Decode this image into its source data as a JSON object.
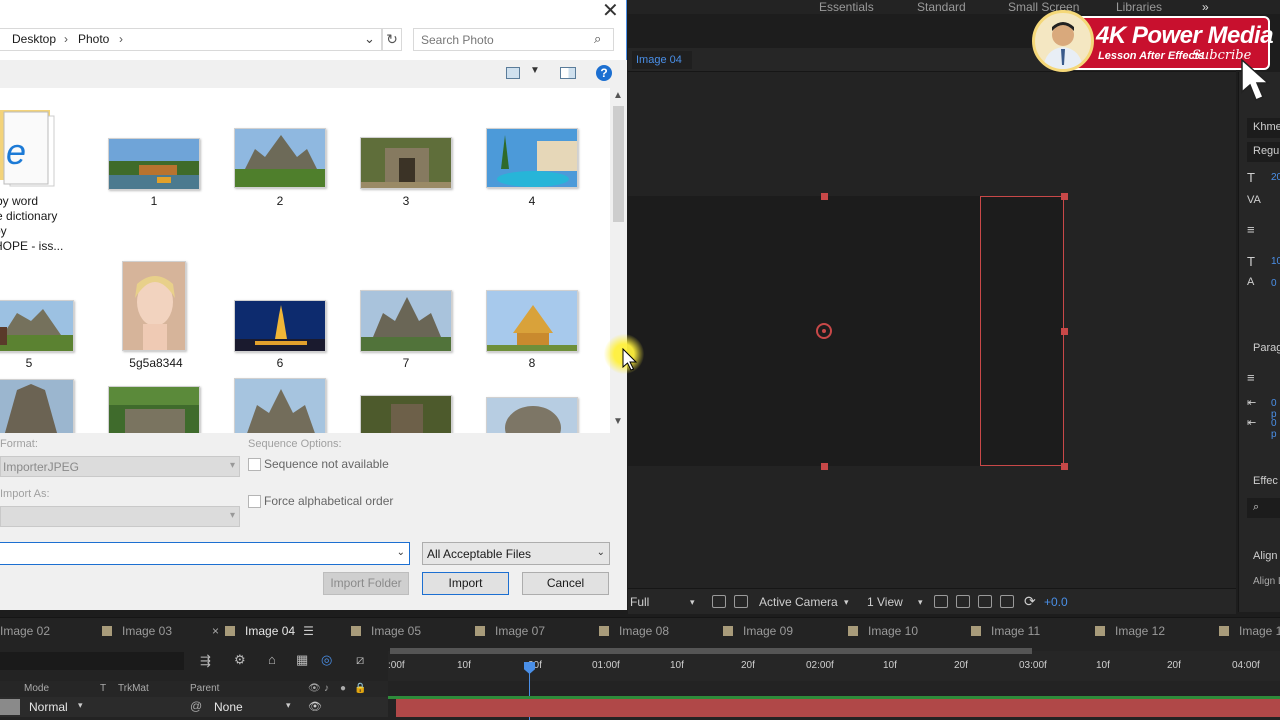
{
  "workspace": {
    "tabs": [
      "Essentials",
      "Standard",
      "Small Screen",
      "Libraries"
    ]
  },
  "composition": {
    "tab_label": "Image 04"
  },
  "logo": {
    "title": "4K Power Media",
    "subtitle": "Lesson After Effects",
    "subscribe": "Subcribe"
  },
  "viewer_bar": {
    "resolution": "Full",
    "camera": "Active Camera",
    "views": "1 View",
    "exposure": "+0.0"
  },
  "right_panel": {
    "font_family": "Khme",
    "font_style": "Regul",
    "size_value": "20",
    "leading_value": "10",
    "baseline_value": "0",
    "paragraph_label": "Parag",
    "indent1": "0 p",
    "indent2": "0 p",
    "effects_label": "Effec",
    "align_label": "Align",
    "align_layers": "Align L"
  },
  "dialog": {
    "breadcrumb": [
      "Desktop",
      "Photo"
    ],
    "search_placeholder": "Search Photo",
    "files": [
      {
        "label": "...rd by word\n...ture dictionary\n...w by\n...NIHOPE - iss..."
      },
      {
        "label": "1"
      },
      {
        "label": "2"
      },
      {
        "label": "3"
      },
      {
        "label": "4"
      },
      {
        "label": "5"
      },
      {
        "label": "5g5a8344"
      },
      {
        "label": "6"
      },
      {
        "label": "7"
      },
      {
        "label": "8"
      }
    ],
    "format_label": "Format:",
    "format_value": "ImporterJPEG",
    "import_as_label": "Import As:",
    "sequence_label": "Sequence Options:",
    "sequence_checkbox": "Sequence not available",
    "alpha_checkbox": "Force alphabetical order",
    "filename_value": "",
    "filetype_value": "All Acceptable Files",
    "buttons": {
      "import_folder": "Import Folder",
      "import": "Import",
      "cancel": "Cancel"
    }
  },
  "timeline": {
    "tabs": [
      "Image 02",
      "Image 03",
      "Image 04",
      "Image 05",
      "Image 07",
      "Image 08",
      "Image 09",
      "Image 10",
      "Image 11",
      "Image 12",
      "Image 1"
    ],
    "active_tab": "Image 04",
    "ruler": [
      ":00f",
      "10f",
      "20f",
      "01:00f",
      "10f",
      "20f",
      "02:00f",
      "10f",
      "20f",
      "03:00f",
      "10f",
      "20f",
      "04:00f"
    ],
    "columns": {
      "mode": "Mode",
      "t": "T",
      "trkmat": "TrkMat",
      "parent": "Parent"
    },
    "row": {
      "mode": "Normal",
      "parent": "None"
    }
  }
}
